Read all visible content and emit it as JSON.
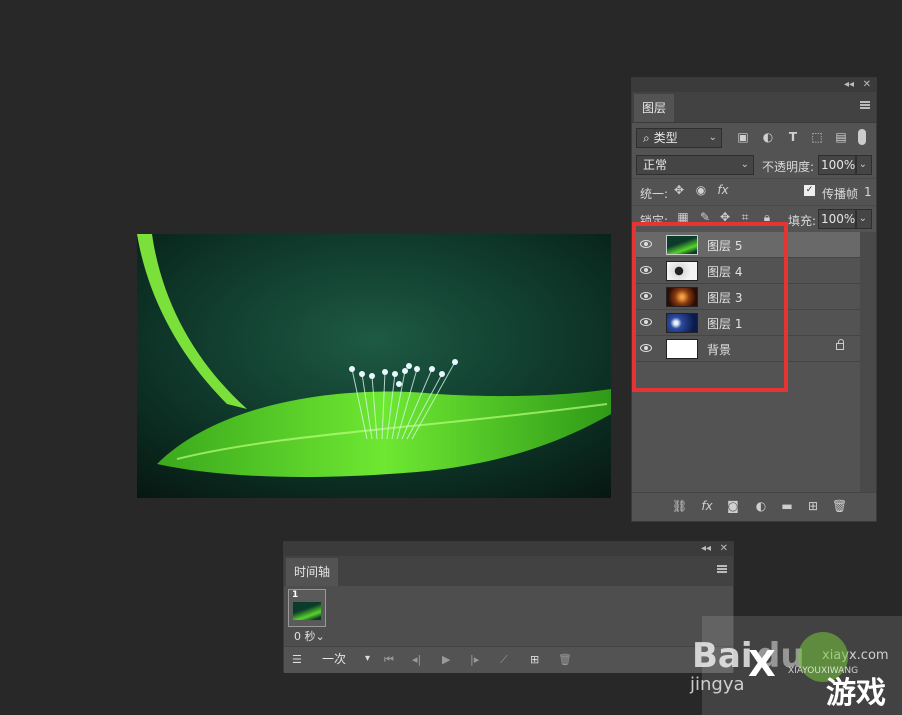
{
  "layers_panel": {
    "tab": "图层",
    "filter_kind": "类型",
    "blend_mode": "正常",
    "opacity_label": "不透明度:",
    "opacity_value": "100%",
    "unify_label": "统一:",
    "propagate_label": "传播帧",
    "propagate_value": "1",
    "lock_label": "锁定:",
    "fill_label": "填充:",
    "fill_value": "100%",
    "layers": [
      {
        "name": "图层 5",
        "selected": true,
        "thumb": "leaf"
      },
      {
        "name": "图层 4",
        "selected": false,
        "thumb": "white-dark"
      },
      {
        "name": "图层 3",
        "selected": false,
        "thumb": "orange"
      },
      {
        "name": "图层 1",
        "selected": false,
        "thumb": "blue"
      },
      {
        "name": "背景",
        "selected": false,
        "thumb": "white",
        "locked": true
      }
    ]
  },
  "timeline": {
    "tab": "时间轴",
    "frame_number": "1",
    "frame_delay": "0 秒",
    "loop_option": "一次"
  },
  "watermark": {
    "baidu": "Bai",
    "du": "du",
    "jingyan": "jingya",
    "site": "xiayx.com",
    "brand": "游戏",
    "sub": "XIAYOUXIWANG"
  },
  "highlight_color": "#e43434"
}
